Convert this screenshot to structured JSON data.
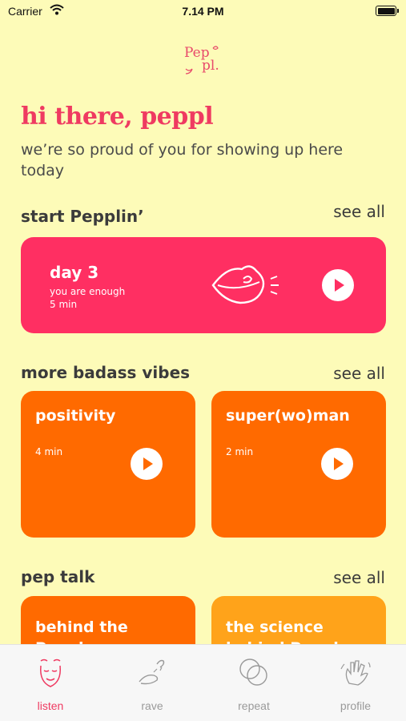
{
  "status_bar": {
    "carrier": "Carrier",
    "time": "7.14 PM"
  },
  "logo": {
    "line1": "Pep",
    "line2": "pl."
  },
  "greeting": "hi there, peppl",
  "subtitle": "we’re so proud of you for showing up here today",
  "sections": {
    "start": {
      "title": "start Pepplin’",
      "see_all": "see all"
    },
    "vibes": {
      "title": "more badass vibes",
      "see_all": "see all"
    },
    "pep_talk": {
      "title": "pep talk",
      "see_all": "see all"
    }
  },
  "featured": {
    "title": "day 3",
    "subtitle": "you are enough",
    "duration": "5 min"
  },
  "vibes_cards": [
    {
      "title": "positivity",
      "duration": "4 min"
    },
    {
      "title": "super(wo)man",
      "duration": "2 min"
    }
  ],
  "pep_talk_cards": [
    {
      "title": "behind the Peppl."
    },
    {
      "title": "the science behind Peppl."
    }
  ],
  "tabs": [
    {
      "label": "listen",
      "icon": "smiling-face-icon",
      "active": true
    },
    {
      "label": "rave",
      "icon": "rave-hands-icon",
      "active": false
    },
    {
      "label": "repeat",
      "icon": "repeat-circles-icon",
      "active": false
    },
    {
      "label": "profile",
      "icon": "hand-wave-icon",
      "active": false
    }
  ],
  "colors": {
    "background": "#fdfbb8",
    "accent_pink": "#ef3a61",
    "featured_card": "#ff2f62",
    "orange_card": "#ff6a00",
    "gold_card": "#ffa31a"
  }
}
